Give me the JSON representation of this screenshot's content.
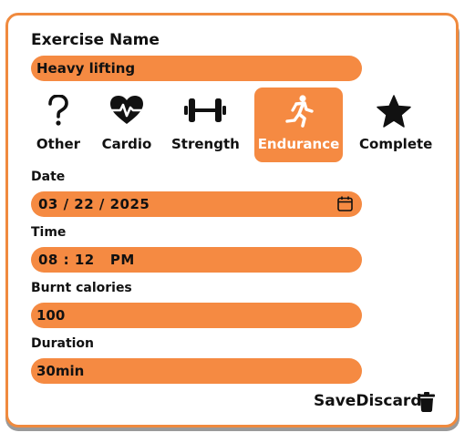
{
  "form": {
    "exercise_name_label": "Exercise Name",
    "exercise_name_value": "Heavy lifting",
    "categories": [
      {
        "label": "Other",
        "icon": "question-icon"
      },
      {
        "label": "Cardio",
        "icon": "heart-pulse-icon"
      },
      {
        "label": "Strength",
        "icon": "dumbbell-icon"
      },
      {
        "label": "Endurance",
        "icon": "running-icon",
        "selected": true
      },
      {
        "label": "Complete",
        "icon": "star-icon"
      }
    ],
    "date_label": "Date",
    "date_value": "03 / 22 / 2025",
    "time_label": "Time",
    "time_value": "08 : 12   PM",
    "burnt_calories_label": "Burnt calories",
    "burnt_calories_value": "100",
    "duration_label": "Duration",
    "duration_value": "30min",
    "save_label": "Save",
    "discard_label": "Discard"
  },
  "colors": {
    "accent": "#f58a42",
    "border": "#f08a3e",
    "text": "#111111"
  }
}
